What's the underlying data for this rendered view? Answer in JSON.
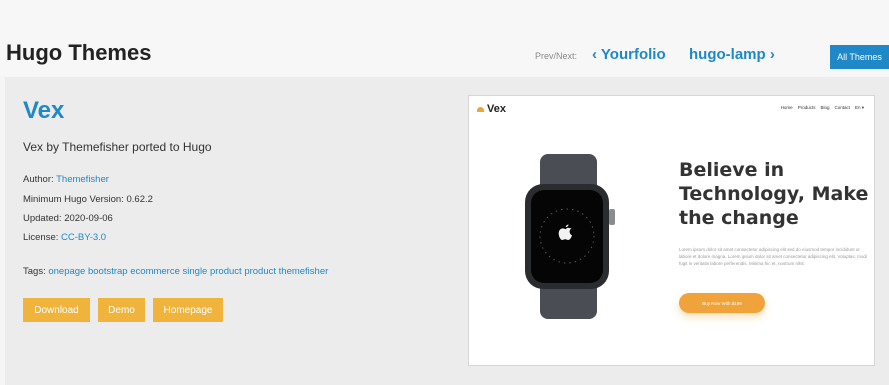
{
  "header": {
    "site_title": "Hugo Themes",
    "prevnext_label": "Prev/Next:",
    "prev": {
      "chevron": "‹",
      "label": "Yourfolio"
    },
    "next": {
      "chevron": "›",
      "label": "hugo-lamp"
    },
    "all_themes_label": "All Themes",
    "accent_color": "#1e88c8"
  },
  "theme": {
    "name": "Vex",
    "description": "Vex by Themefisher ported to Hugo",
    "author_label": "Author:",
    "author": "Themefisher",
    "min_version_label": "Minimum Hugo Version:",
    "min_version": "0.62.2",
    "updated_label": "Updated:",
    "updated": "2020-09-06",
    "license_label": "License:",
    "license": "CC-BY-3.0",
    "tags_label": "Tags:",
    "tags": [
      "onepage",
      "bootstrap",
      "ecommerce",
      "single product",
      "product",
      "themefisher"
    ]
  },
  "buttons": {
    "download": "Download",
    "demo": "Demo",
    "homepage": "Homepage",
    "color": "#f0b43c"
  },
  "preview": {
    "logo_text": "Vex",
    "nav": [
      "Home",
      "Products",
      "Blog",
      "Contact",
      "En ▾"
    ],
    "headline": "Believe in Technology, Make the change",
    "paragraph": "Lorem ipsum dolor sit amet consectetur adipiscing elit sed do eiusmod tempor incididunt ut labore et dolore magna. Lorem ipsum dolor sit amet consectetur adipiscing elit. Voluptas, modi fugit in veritatis labore perferendis. Minima hic et, nostrum nihil.",
    "cta": "Buy Now With $199",
    "cta_color": "#f0a33a",
    "image": "smartwatch-icon"
  }
}
